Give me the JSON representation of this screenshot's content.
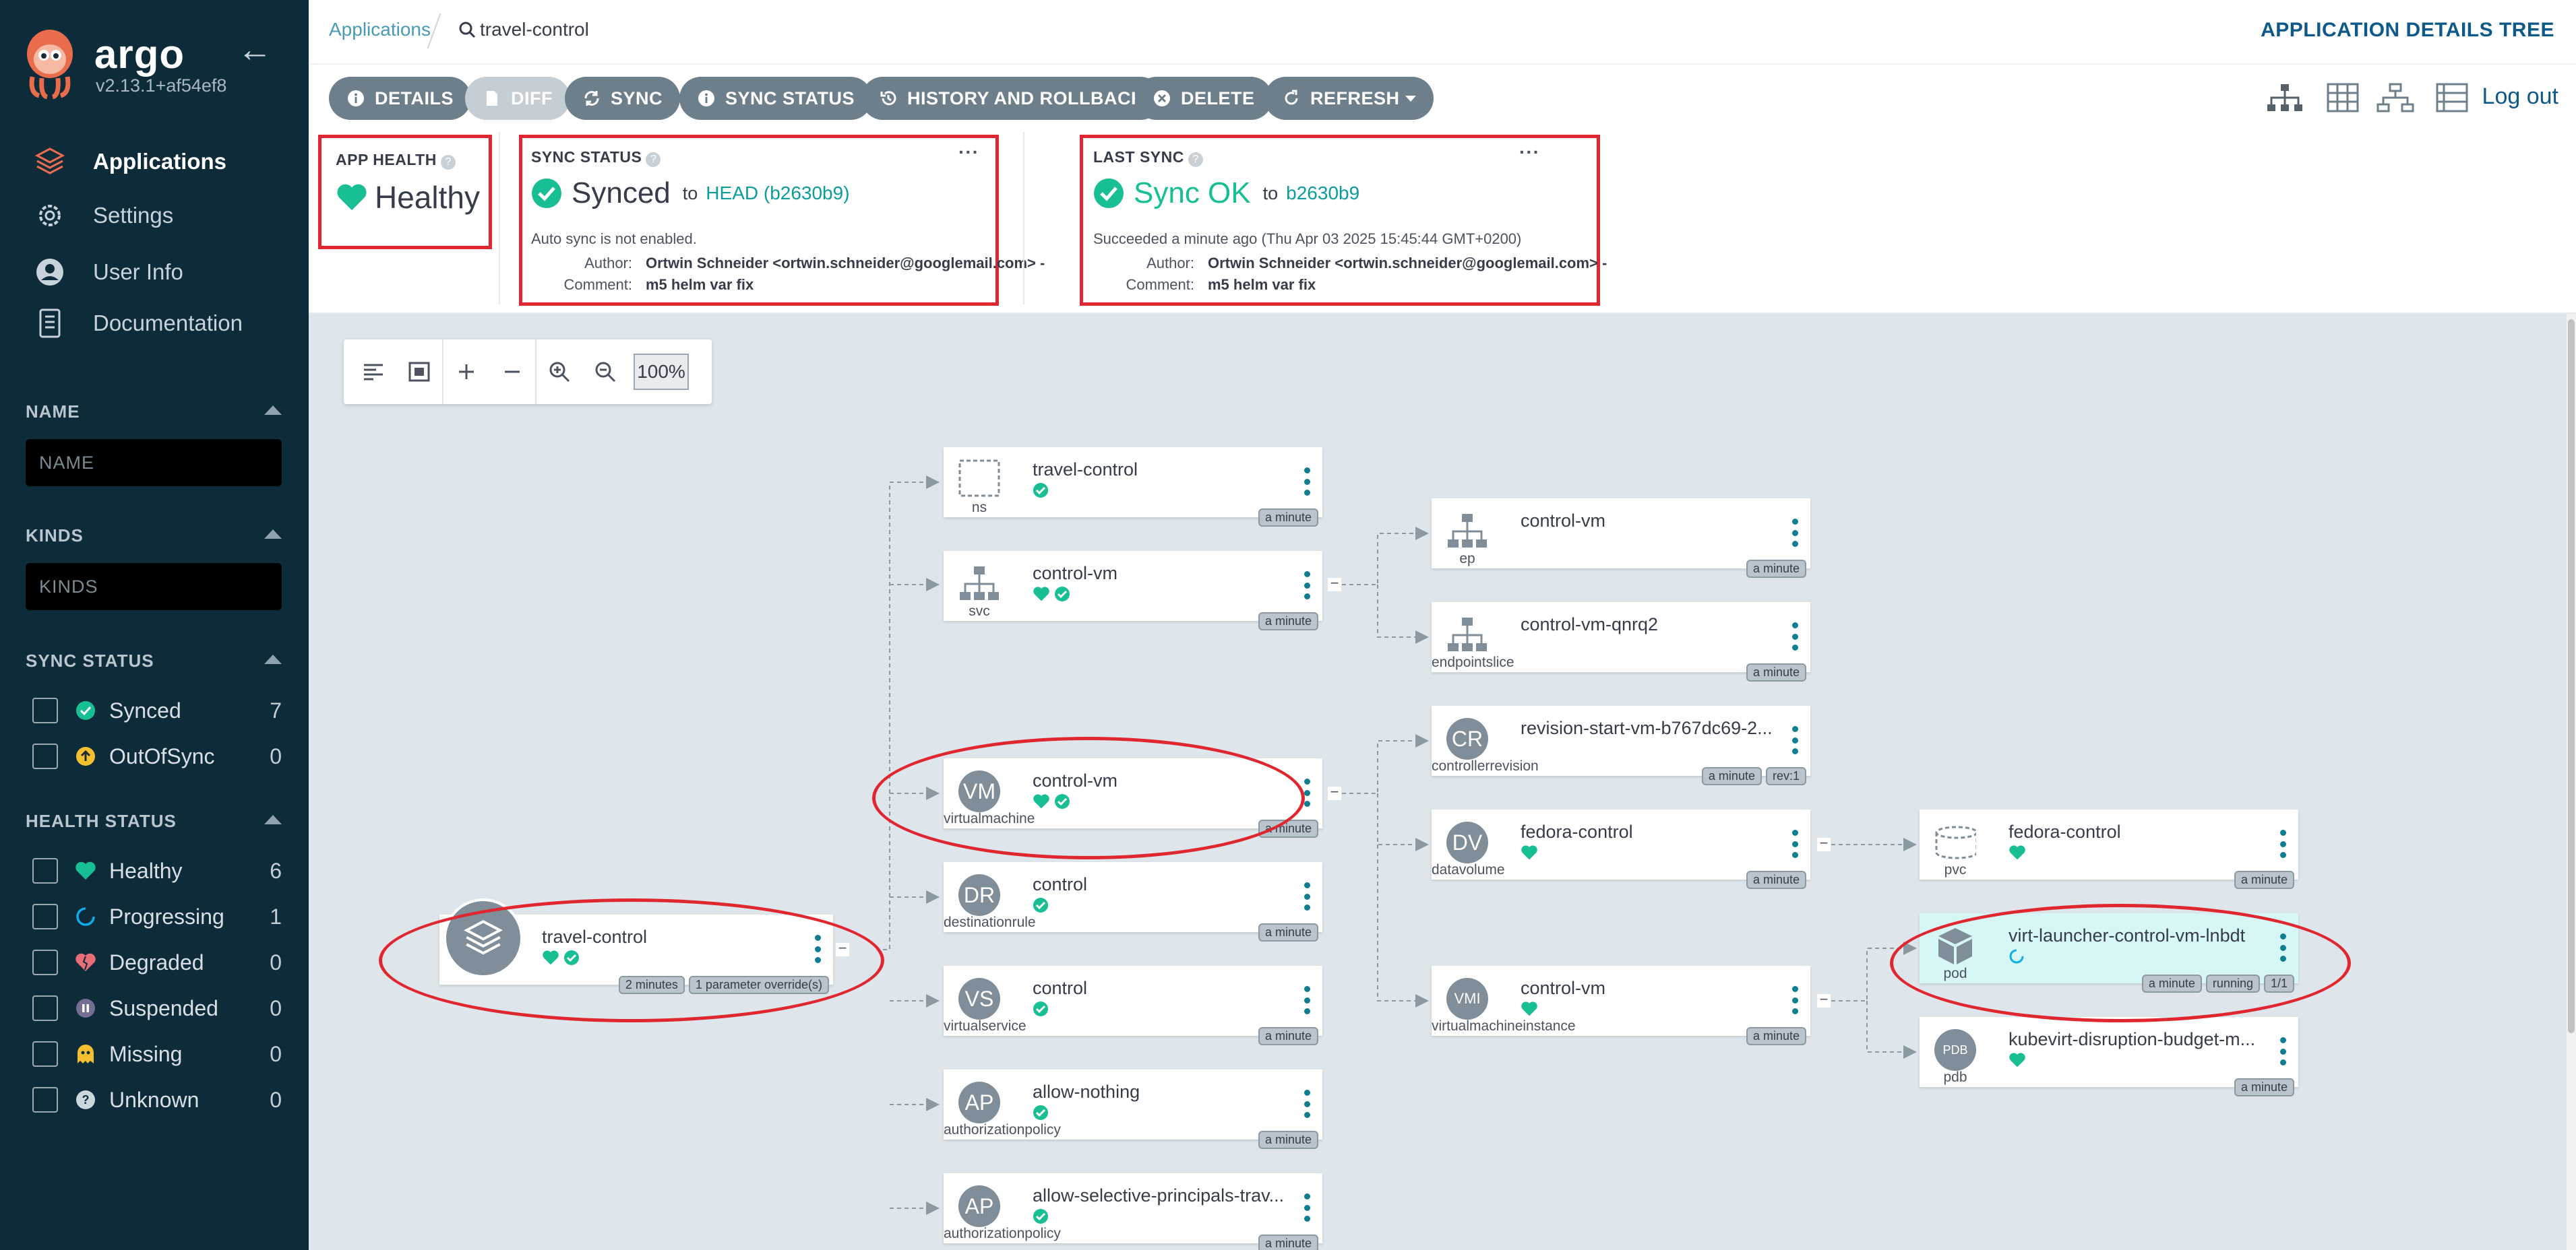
{
  "app": {
    "brand": "argo",
    "version": "v2.13.1+af54ef8"
  },
  "sidebar": {
    "nav": [
      {
        "label": "Applications",
        "icon": "stack-icon"
      },
      {
        "label": "Settings",
        "icon": "gear-icon"
      },
      {
        "label": "User Info",
        "icon": "user-icon"
      },
      {
        "label": "Documentation",
        "icon": "book-icon"
      }
    ],
    "name_section": "NAME",
    "name_placeholder": "NAME",
    "kinds_section": "KINDS",
    "kinds_placeholder": "KINDS",
    "sync_section": "SYNC STATUS",
    "sync_filters": [
      {
        "label": "Synced",
        "count": "7"
      },
      {
        "label": "OutOfSync",
        "count": "0"
      }
    ],
    "health_section": "HEALTH STATUS",
    "health_filters": [
      {
        "label": "Healthy",
        "count": "6"
      },
      {
        "label": "Progressing",
        "count": "1"
      },
      {
        "label": "Degraded",
        "count": "0"
      },
      {
        "label": "Suspended",
        "count": "0"
      },
      {
        "label": "Missing",
        "count": "0"
      },
      {
        "label": "Unknown",
        "count": "0"
      }
    ]
  },
  "header": {
    "breadcrumb_root": "Applications",
    "breadcrumb_current": "travel-control",
    "title": "APPLICATION DETAILS TREE",
    "logout": "Log out"
  },
  "toolbar": {
    "buttons": [
      "DETAILS",
      "DIFF",
      "SYNC",
      "SYNC STATUS",
      "HISTORY AND ROLLBACK",
      "DELETE",
      "REFRESH"
    ]
  },
  "status": {
    "app_health_label": "APP HEALTH",
    "app_health_value": "Healthy",
    "sync_status_label": "SYNC STATUS",
    "sync_status_value": "Synced",
    "sync_to": "to",
    "sync_revision": "HEAD (b2630b9)",
    "auto_sync": "Auto sync is not enabled.",
    "author_key": "Author:",
    "author_value": "Ortwin Schneider <ortwin.schneider@googlemail.com> -",
    "comment_key": "Comment:",
    "comment_value": "m5 helm var fix",
    "last_sync_label": "LAST SYNC",
    "last_sync_value": "Sync OK",
    "last_sync_to": "to",
    "last_sync_revision": "b2630b9",
    "last_sync_time": "Succeeded a minute ago (Thu Apr 03 2025 15:45:44 GMT+0200)"
  },
  "zoom": {
    "level": "100%"
  },
  "tree": {
    "root": {
      "name": "travel-control",
      "tags": [
        "2 minutes",
        "1 parameter override(s)"
      ]
    },
    "level1": [
      {
        "name": "travel-control",
        "kind": "ns",
        "tags": [
          "a minute"
        ]
      },
      {
        "name": "control-vm",
        "kind": "svc",
        "tags": [
          "a minute"
        ]
      },
      {
        "name": "control-vm",
        "kind": "virtualmachine",
        "abbr": "VM",
        "tags": [
          "a minute"
        ]
      },
      {
        "name": "control",
        "kind": "destinationrule",
        "abbr": "DR",
        "tags": [
          "a minute"
        ]
      },
      {
        "name": "control",
        "kind": "virtualservice",
        "abbr": "VS",
        "tags": [
          "a minute"
        ]
      },
      {
        "name": "allow-nothing",
        "kind": "authorizationpolicy",
        "abbr": "AP",
        "tags": [
          "a minute"
        ]
      },
      {
        "name": "allow-selective-principals-trav...",
        "kind": "authorizationpolicy",
        "abbr": "AP",
        "tags": [
          "a minute"
        ]
      }
    ],
    "level2": [
      {
        "name": "control-vm",
        "kind": "ep",
        "tags": [
          "a minute"
        ]
      },
      {
        "name": "control-vm-qnrq2",
        "kind": "endpointslice",
        "tags": [
          "a minute"
        ]
      },
      {
        "name": "revision-start-vm-b767dc69-2...",
        "kind": "controllerrevision",
        "abbr": "CR",
        "tags": [
          "a minute",
          "rev:1"
        ]
      },
      {
        "name": "fedora-control",
        "kind": "datavolume",
        "abbr": "DV",
        "tags": [
          "a minute"
        ]
      },
      {
        "name": "control-vm",
        "kind": "virtualmachineinstance",
        "abbr": "VMI",
        "tags": [
          "a minute"
        ]
      }
    ],
    "level3": [
      {
        "name": "fedora-control",
        "kind": "pvc",
        "tags": [
          "a minute"
        ]
      },
      {
        "name": "virt-launcher-control-vm-lnbdt",
        "kind": "pod",
        "tags": [
          "a minute",
          "running",
          "1/1"
        ]
      },
      {
        "name": "kubevirt-disruption-budget-m...",
        "kind": "pdb",
        "abbr": "PDB",
        "tags": [
          "a minute"
        ]
      }
    ]
  },
  "colors": {
    "sidebar": "#0e2b3a",
    "healthy": "#18be94",
    "progressing": "#0dadea",
    "annotation": "#e0262e",
    "accent": "#0d5a8a"
  }
}
